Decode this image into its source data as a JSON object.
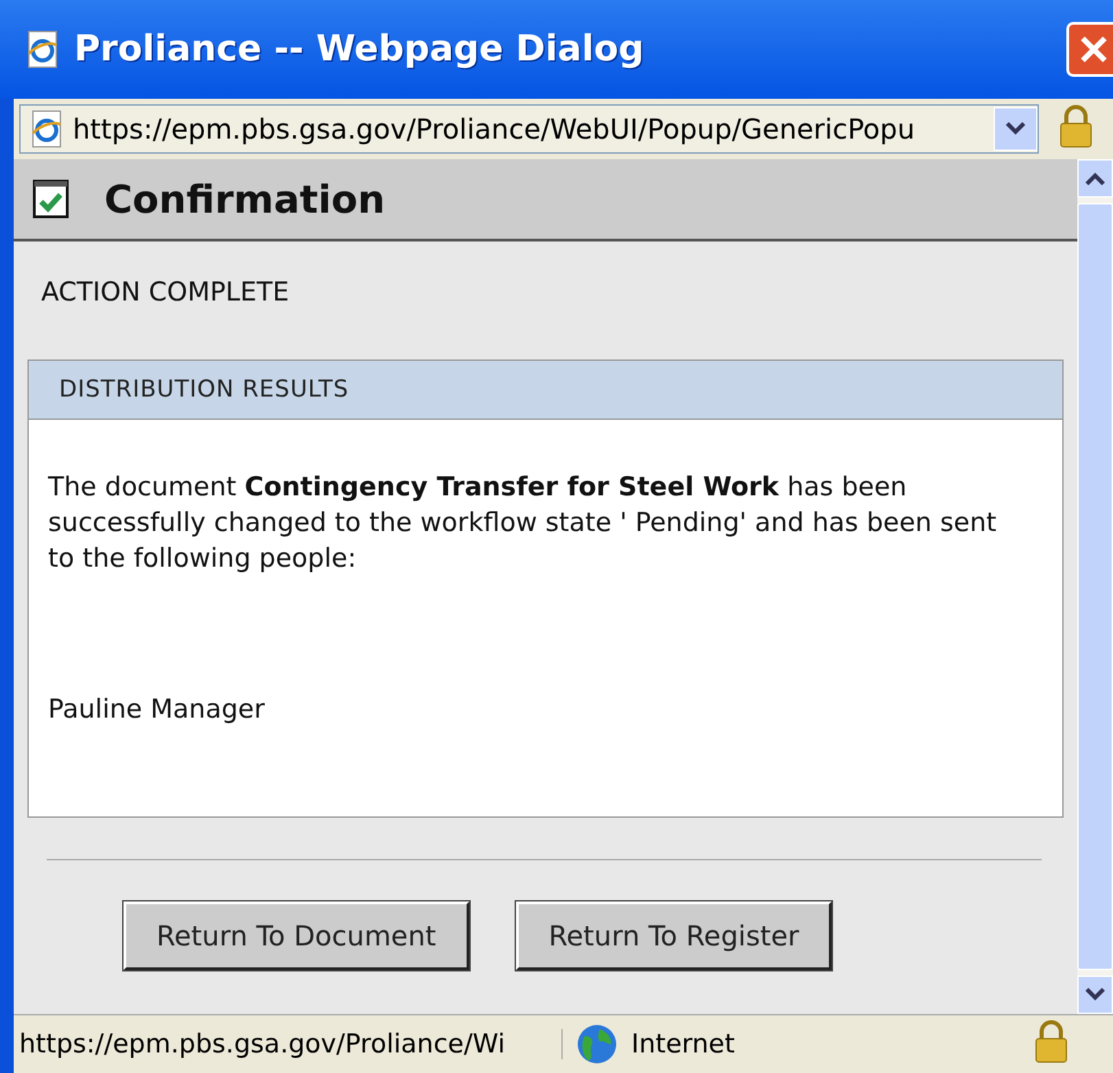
{
  "window": {
    "title": "Proliance -- Webpage Dialog",
    "address": "https://epm.pbs.gsa.gov/Proliance/WebUI/Popup/GenericPopu"
  },
  "header": {
    "title": "Confirmation"
  },
  "status": "ACTION COMPLETE",
  "panel": {
    "title": "DISTRIBUTION RESULTS",
    "message": "The document **Contingency Transfer for Steel Work** has been successfully changed to the workflow state ' Pending' and has been sent to the following people:",
    "people": [
      "Pauline Manager"
    ]
  },
  "buttons": [
    "Return To Document",
    "Return To Register"
  ],
  "status_bar": {
    "url": "https://epm.pbs.gsa.gov/Proliance/Wi",
    "zone": "Internet"
  }
}
